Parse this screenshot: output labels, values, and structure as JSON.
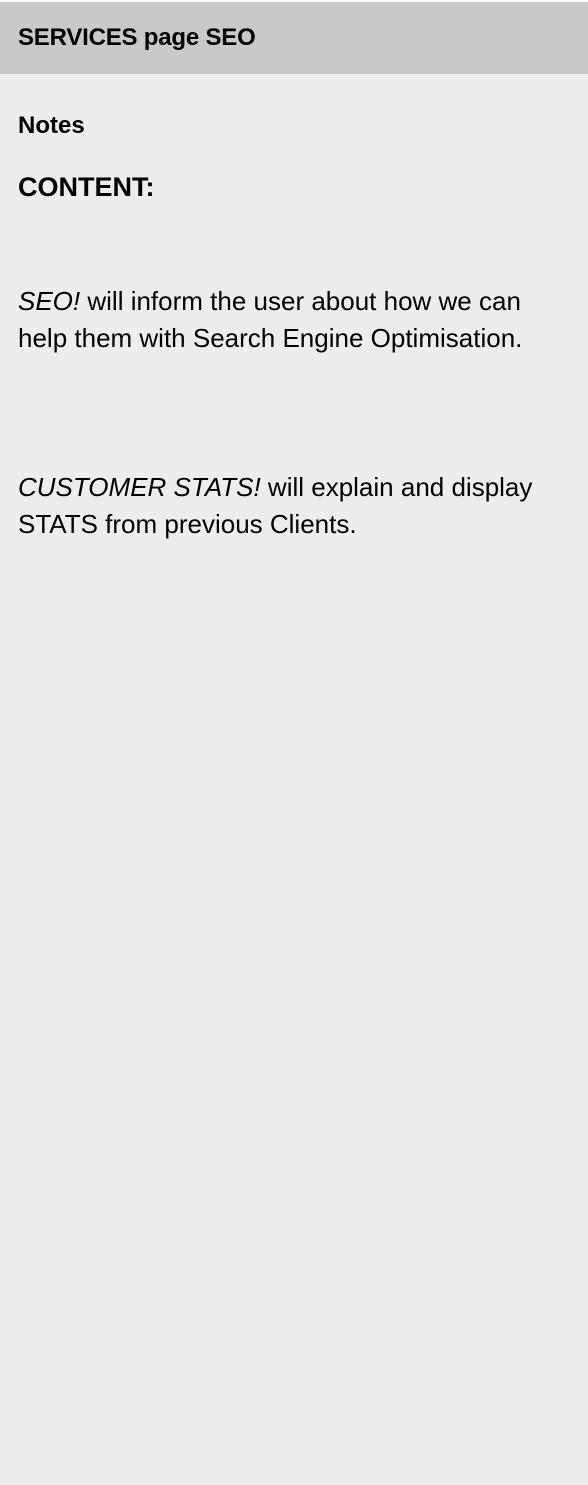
{
  "panel": {
    "title": "SERVICES page SEO"
  },
  "notes": {
    "label": "Notes",
    "content_heading": "CONTENT:",
    "paragraphs": [
      {
        "lead": "SEO!",
        "text": " will inform the user about how we can help them with Search Engine Optimisation."
      },
      {
        "lead": "CUSTOMER STATS!",
        "text": " will explain and display STATS from previous Clients."
      }
    ]
  },
  "colors": {
    "header_background": "#c8c9ca",
    "panel_background": "#ededed",
    "text": "#000000"
  }
}
